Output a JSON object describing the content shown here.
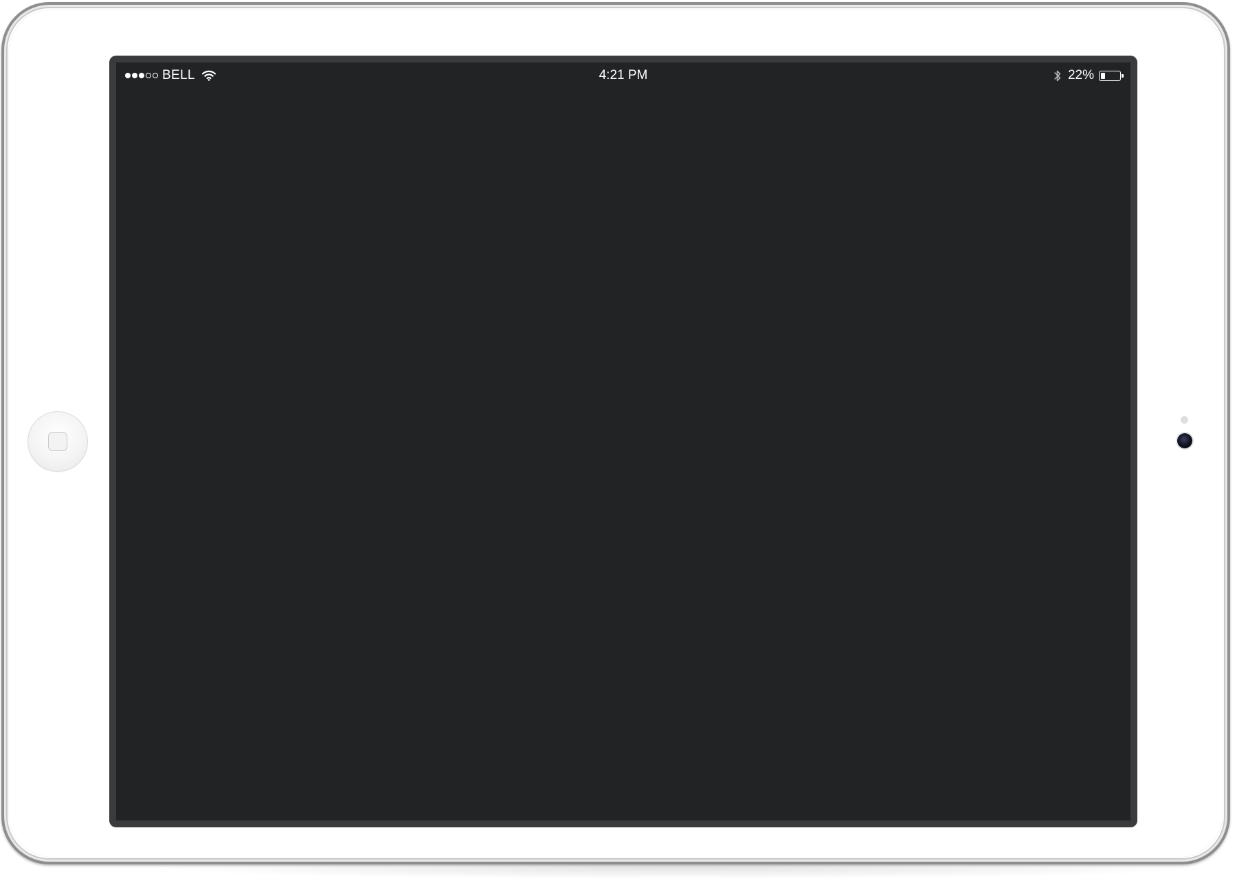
{
  "status_bar": {
    "signal_strength": {
      "filled": 3,
      "total": 5
    },
    "carrier": "BELL",
    "wifi_icon": "wifi-icon",
    "time": "4:21 PM",
    "bluetooth_icon": "bluetooth-icon",
    "battery_text": "22%",
    "battery_level": 0.22
  },
  "device": {
    "frame_color": "#ffffff",
    "bezel_color": "#3a3b3d",
    "screen_color": "#222325"
  }
}
